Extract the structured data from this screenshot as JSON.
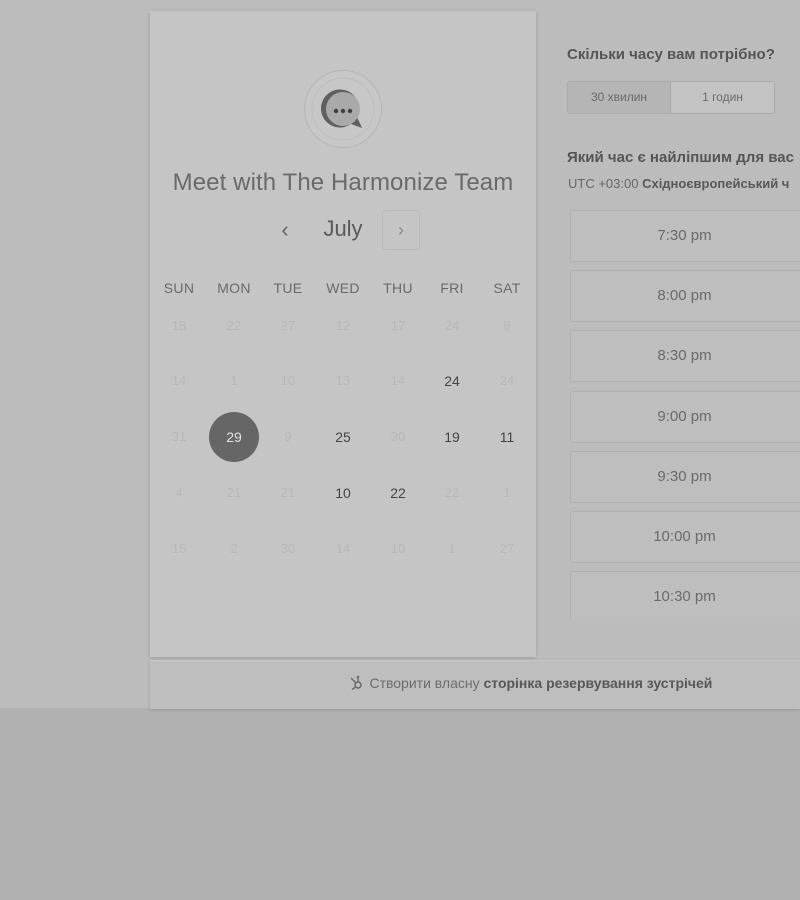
{
  "meeting": {
    "title": "Meet with The Harmonize Team",
    "logo_icon": "chat-bubble-icon"
  },
  "calendar": {
    "month": "July",
    "prev_icon": "‹",
    "next_icon": "›",
    "weekdays": [
      "SUN",
      "MON",
      "TUE",
      "WED",
      "THU",
      "FRI",
      "SAT"
    ],
    "weeks": [
      [
        {
          "d": "18",
          "s": "off"
        },
        {
          "d": "22",
          "s": "off"
        },
        {
          "d": "27",
          "s": "off"
        },
        {
          "d": "12",
          "s": "off"
        },
        {
          "d": "17",
          "s": "off"
        },
        {
          "d": "24",
          "s": "off"
        },
        {
          "d": "8",
          "s": "off"
        }
      ],
      [
        {
          "d": "14",
          "s": "off"
        },
        {
          "d": "1",
          "s": "off"
        },
        {
          "d": "10",
          "s": "off"
        },
        {
          "d": "13",
          "s": "off"
        },
        {
          "d": "14",
          "s": "off"
        },
        {
          "d": "24",
          "s": "on"
        },
        {
          "d": "24",
          "s": "off"
        }
      ],
      [
        {
          "d": "31",
          "s": "off"
        },
        {
          "d": "29",
          "s": "sel"
        },
        {
          "d": "9",
          "s": "off"
        },
        {
          "d": "25",
          "s": "on"
        },
        {
          "d": "30",
          "s": "off"
        },
        {
          "d": "19",
          "s": "on"
        },
        {
          "d": "11",
          "s": "on"
        }
      ],
      [
        {
          "d": "4",
          "s": "off"
        },
        {
          "d": "21",
          "s": "off"
        },
        {
          "d": "21",
          "s": "off"
        },
        {
          "d": "10",
          "s": "on"
        },
        {
          "d": "22",
          "s": "on"
        },
        {
          "d": "22",
          "s": "off"
        },
        {
          "d": "1",
          "s": "off"
        }
      ],
      [
        {
          "d": "15",
          "s": "off"
        },
        {
          "d": "2",
          "s": "off"
        },
        {
          "d": "30",
          "s": "off"
        },
        {
          "d": "14",
          "s": "off"
        },
        {
          "d": "10",
          "s": "off"
        },
        {
          "d": "1",
          "s": "off"
        },
        {
          "d": "27",
          "s": "off"
        }
      ]
    ]
  },
  "duration": {
    "question": "Скільки часу вам потрібно?",
    "options": [
      "30 хвилин",
      "1 годин"
    ],
    "selected": "30 хвилин"
  },
  "time": {
    "question": "Який час є найліпшим для вас",
    "tz_prefix": "UTC +03:00",
    "tz_name": "Східноєвропейський ч",
    "slots": [
      "7:30 pm",
      "8:00 pm",
      "8:30 pm",
      "9:00 pm",
      "9:30 pm",
      "10:00 pm",
      "10:30 pm"
    ]
  },
  "footer": {
    "icon": "hubspot-sprocket-icon",
    "text_plain": "Створити власну",
    "text_bold": "сторінка резервування зустрічей"
  },
  "colors": {
    "selected_day": "#666666",
    "background": "#b1b1b1",
    "card": "#c5c5c5"
  }
}
